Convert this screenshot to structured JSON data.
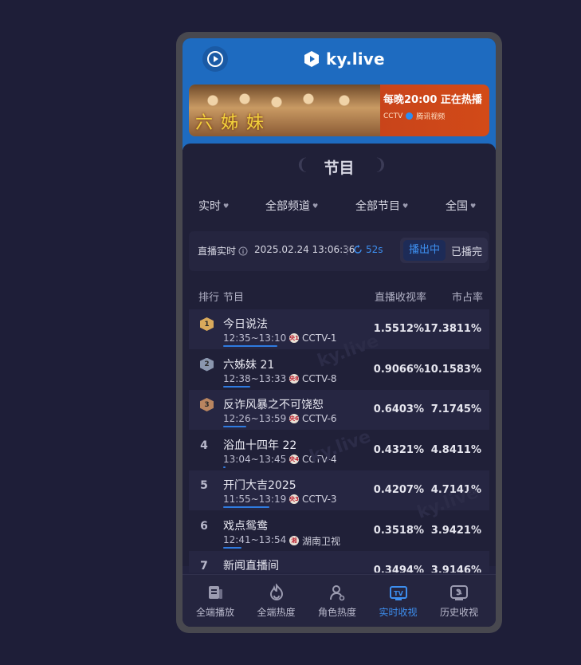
{
  "app": {
    "brand": "ky.live"
  },
  "banner": {
    "title": "六姊妹",
    "line1": "每晚20:00 正在热播",
    "line2a": "CCTV",
    "line2b": "腾讯视频"
  },
  "section": {
    "title": "节目"
  },
  "filters": [
    {
      "label": "实时"
    },
    {
      "label": "全部频道"
    },
    {
      "label": "全部节目"
    },
    {
      "label": "全国"
    }
  ],
  "meta": {
    "label": "直播实时",
    "timestamp": "2025.02.24 13:06:36",
    "refresh": "52s",
    "toggle_live": "播出中",
    "toggle_done": "已播完"
  },
  "table": {
    "headers": {
      "rank": "排行",
      "program": "节目",
      "rating": "直播收视率",
      "share": "市占率"
    },
    "rows": [
      {
        "rank": "1",
        "name": "今日说法",
        "time": "12:35~13:10",
        "channel": "CCTV-1",
        "rating": "1.5512%",
        "share": "17.3811%",
        "progress": 1.0,
        "medal": "#d9a95b",
        "chan_badge": "央1"
      },
      {
        "rank": "2",
        "name": "六姊妹 21",
        "time": "12:38~13:33",
        "channel": "CCTV-8",
        "rating": "0.9066%",
        "share": "10.1583%",
        "progress": 0.5,
        "medal": "#8a96ae",
        "chan_badge": "央8"
      },
      {
        "rank": "3",
        "name": "反诈风暴之不可饶恕",
        "time": "12:26~13:59",
        "channel": "CCTV-6",
        "rating": "0.6403%",
        "share": "7.1745%",
        "progress": 0.43,
        "medal": "#b98560",
        "chan_badge": "央6"
      },
      {
        "rank": "4",
        "name": "浴血十四年 22",
        "time": "13:04~13:45",
        "channel": "CCTV-4",
        "rating": "0.4321%",
        "share": "4.8411%",
        "progress": 0.05,
        "medal": "",
        "chan_badge": "央4"
      },
      {
        "rank": "5",
        "name": "开门大吉2025",
        "time": "11:55~13:19",
        "channel": "CCTV-3",
        "rating": "0.4207%",
        "share": "4.7141%",
        "progress": 0.85,
        "medal": "",
        "chan_badge": "央3"
      },
      {
        "rank": "6",
        "name": "戏点鸳鸯",
        "time": "12:41~13:54",
        "channel": "湖南卫视",
        "rating": "0.3518%",
        "share": "3.9421%",
        "progress": 0.34,
        "medal": "",
        "chan_badge": "湘"
      },
      {
        "rank": "7",
        "name": "新闻直播间",
        "time": "",
        "channel": "",
        "rating": "0.3494%",
        "share": "3.9146%",
        "progress": 0,
        "medal": "",
        "chan_badge": ""
      }
    ]
  },
  "tabbar": [
    {
      "label": "全端播放",
      "icon": "newspaper-icon",
      "active": false
    },
    {
      "label": "全端热度",
      "icon": "flame-icon",
      "active": false
    },
    {
      "label": "角色热度",
      "icon": "person-icon",
      "active": false
    },
    {
      "label": "实时收视",
      "icon": "tv-icon",
      "active": true
    },
    {
      "label": "历史收视",
      "icon": "history-tv-icon",
      "active": false
    }
  ],
  "colors": {
    "accent": "#3d8ff0",
    "header": "#1e6bc0",
    "background": "#1e1e38"
  }
}
